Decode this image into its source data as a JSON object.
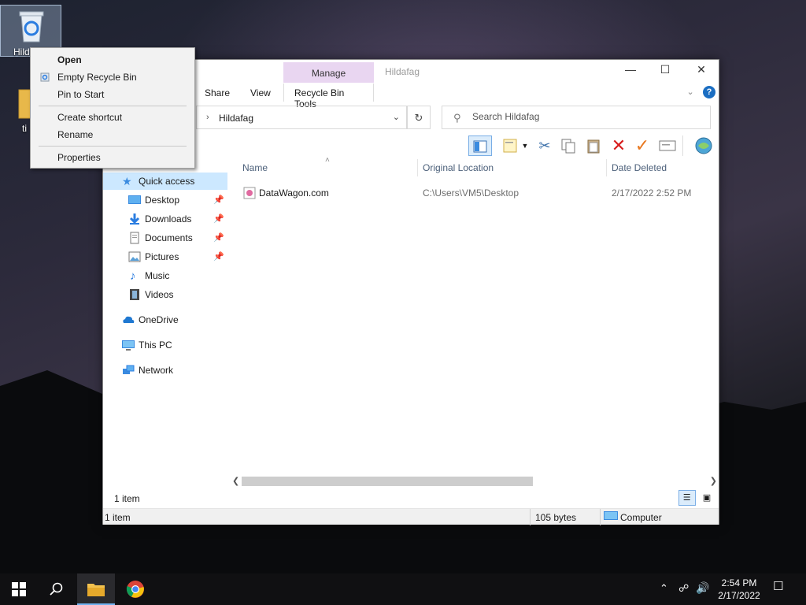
{
  "desktop": {
    "recycle_bin_label": "Hild",
    "folder_label": "ti"
  },
  "context_menu": {
    "items": [
      {
        "label": "Open"
      },
      {
        "label": "Empty Recycle Bin"
      },
      {
        "label": "Pin to Start"
      },
      {
        "label": "Create shortcut"
      },
      {
        "label": "Rename"
      },
      {
        "label": "Properties"
      }
    ]
  },
  "window": {
    "title": "Hildafag",
    "manage_tab": "Manage",
    "ribbon_tabs": [
      "Share",
      "View",
      "Recycle Bin Tools"
    ],
    "address": "Hildafag",
    "search_placeholder": "Search Hildafag"
  },
  "nav": {
    "quick_access": "Quick access",
    "items": [
      "Desktop",
      "Downloads",
      "Documents",
      "Pictures",
      "Music",
      "Videos"
    ],
    "onedrive": "OneDrive",
    "this_pc": "This PC",
    "network": "Network"
  },
  "columns": [
    "Name",
    "Original Location",
    "Date Deleted"
  ],
  "files": [
    {
      "name": "DataWagon.com",
      "location": "C:\\Users\\VM5\\Desktop",
      "date": "2/17/2022 2:52 PM"
    }
  ],
  "item_count": "1 item",
  "status": {
    "items": "1 item",
    "size": "105 bytes",
    "location": "Computer"
  },
  "taskbar": {
    "time": "2:54 PM",
    "date": "2/17/2022"
  },
  "colors": {
    "manage_tab": "#e9d6f1",
    "selection": "#cce8ff",
    "delete_red": "#d81e1e",
    "restore_orange": "#e8771e"
  }
}
